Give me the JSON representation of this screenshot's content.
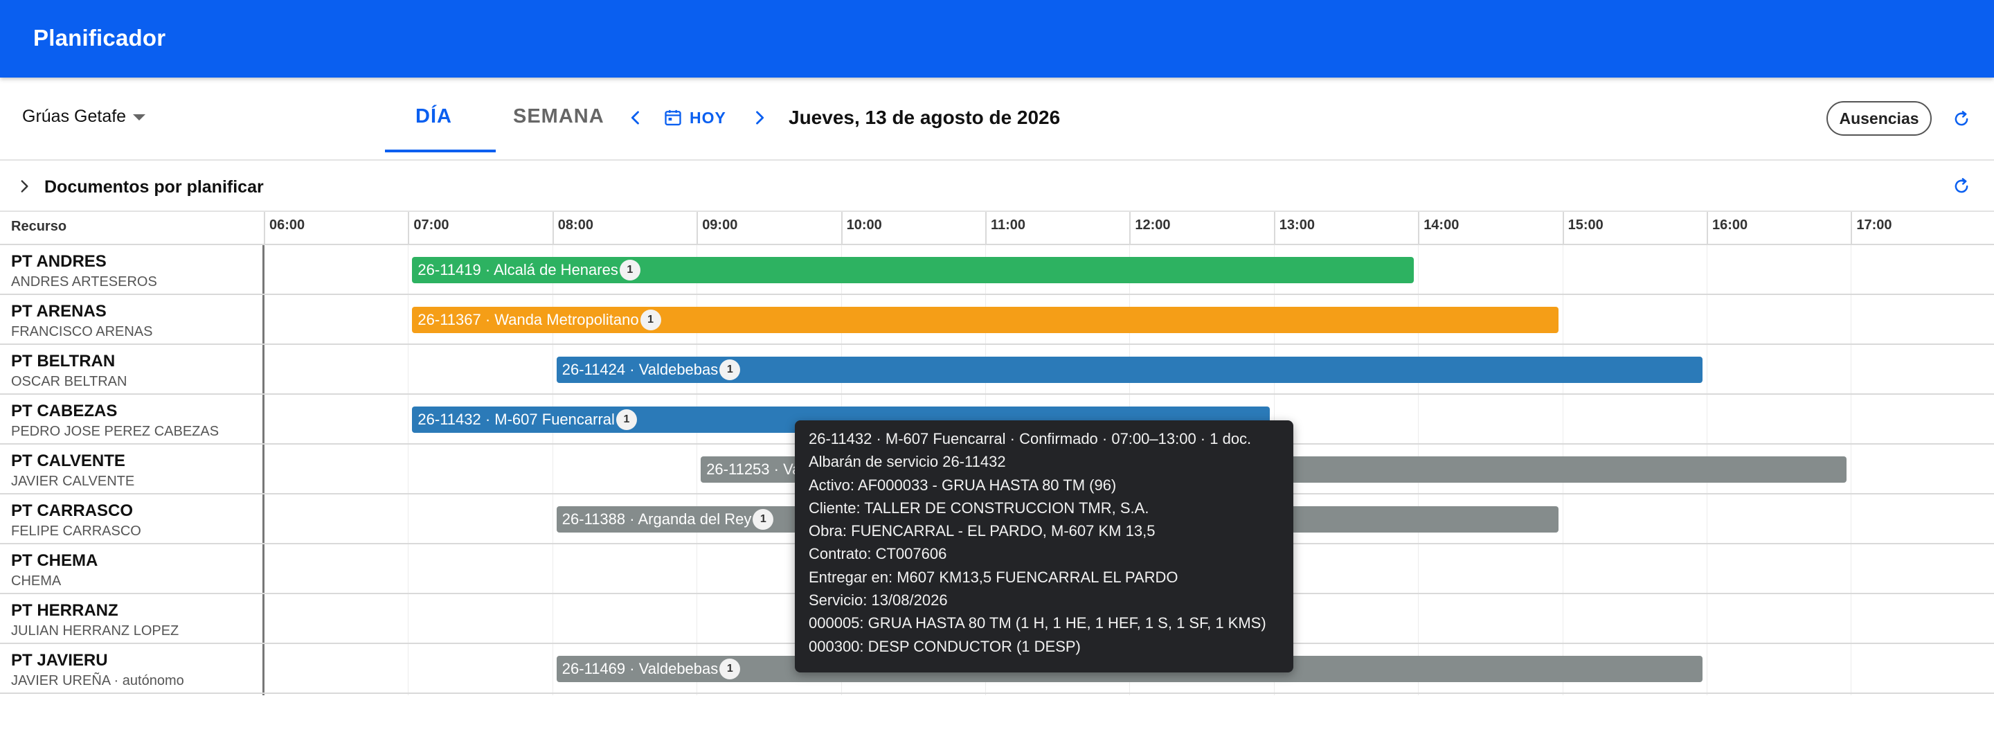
{
  "app": {
    "title": "Planificador"
  },
  "toolbar": {
    "company": "Grúas Getafe",
    "tab_day": "DÍA",
    "tab_week": "SEMANA",
    "today_label": "HOY",
    "date_title": "Jueves, 13 de agosto de 2026",
    "absences_label": "Ausencias"
  },
  "docs": {
    "label": "Documentos por planificar"
  },
  "grid": {
    "resource_header": "Recurso",
    "hours": [
      "06:00",
      "07:00",
      "08:00",
      "09:00",
      "10:00",
      "11:00",
      "12:00",
      "13:00",
      "14:00",
      "15:00",
      "16:00",
      "17:00"
    ],
    "rows": [
      {
        "code": "PT ANDRES",
        "name": "ANDRES ARTESEROS",
        "bars": [
          {
            "label": "26-11419 · Alcalá de Henares",
            "count": "1",
            "start": "07:00",
            "end": "14:00",
            "color": "#2db261"
          }
        ]
      },
      {
        "code": "PT ARENAS",
        "name": "FRANCISCO ARENAS",
        "bars": [
          {
            "label": "26-11367 · Wanda Metropolitano",
            "count": "1",
            "start": "07:00",
            "end": "15:00",
            "color": "#f59e17"
          }
        ]
      },
      {
        "code": "PT BELTRAN",
        "name": "OSCAR BELTRAN",
        "bars": [
          {
            "label": "26-11424 · Valdebebas",
            "count": "1",
            "start": "08:00",
            "end": "16:00",
            "color": "#2b7ab8"
          }
        ]
      },
      {
        "code": "PT CABEZAS",
        "name": "PEDRO JOSE PEREZ CABEZAS",
        "bars": [
          {
            "label": "26-11432 · M-607 Fuencarral",
            "count": "1",
            "start": "07:00",
            "end": "13:00",
            "color": "#2b7ab8"
          }
        ]
      },
      {
        "code": "PT CALVENTE",
        "name": "JAVIER CALVENTE",
        "bars": [
          {
            "label": "26-11253 · Va",
            "count": "",
            "start": "09:00",
            "end": "17:00",
            "color": "#858c8c"
          }
        ]
      },
      {
        "code": "PT CARRASCO",
        "name": "FELIPE CARRASCO",
        "bars": [
          {
            "label": "26-11388 · Arganda del Rey",
            "count": "1",
            "start": "08:00",
            "end": "15:00",
            "color": "#858c8c"
          }
        ]
      },
      {
        "code": "PT CHEMA",
        "name": "CHEMA",
        "bars": []
      },
      {
        "code": "PT HERRANZ",
        "name": "JULIAN HERRANZ LOPEZ",
        "bars": []
      },
      {
        "code": "PT JAVIERU",
        "name": "JAVIER UREÑA · autónomo",
        "bars": [
          {
            "label": "26-11469 · Valdebebas",
            "count": "1",
            "start": "08:00",
            "end": "16:00",
            "color": "#858c8c"
          }
        ]
      }
    ]
  },
  "tooltip": {
    "lines": [
      "26-11432 · M-607 Fuencarral · Confirmado · 07:00–13:00 · 1 doc.",
      "Albarán de servicio 26-11432",
      "Activo: AF000033 - GRUA HASTA 80 TM (96)",
      "Cliente: TALLER DE CONSTRUCCION TMR, S.A.",
      "Obra: FUENCARRAL - EL PARDO, M-607 KM 13,5",
      "Contrato: CT007606",
      "Entregar en: M607 KM13,5 FUENCARRAL EL PARDO",
      "Servicio: 13/08/2026",
      "000005: GRUA HASTA 80 TM (1 H, 1 HE, 1 HEF, 1 S, 1 SF, 1 KMS)",
      "000300: DESP CONDUCTOR (1 DESP)"
    ]
  },
  "icons": {
    "company_dropdown": "caret-down-icon",
    "prev": "chevron-left-icon",
    "next": "chevron-right-icon",
    "today": "calendar-icon",
    "refresh": "refresh-icon",
    "docs_expand": "chevron-right-icon"
  },
  "colors": {
    "primary": "#0a5ff0",
    "green": "#2db261",
    "orange": "#f59e17",
    "blue": "#2b7ab8",
    "gray": "#858c8c"
  }
}
